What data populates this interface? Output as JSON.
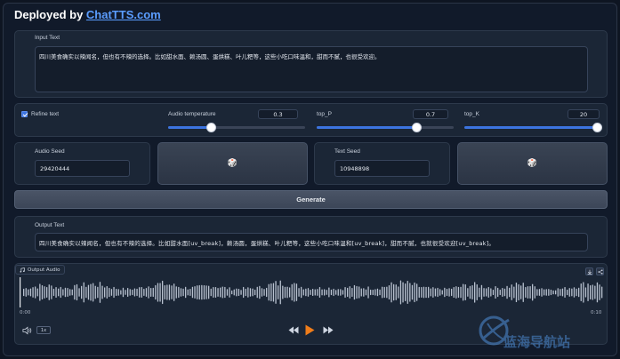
{
  "header": {
    "prefix": "Deployed by ",
    "link": "ChatTTS.com"
  },
  "input": {
    "label": "Input Text",
    "value": "四川美食确实以辣闻名，但也有不辣的选择。比如甜水面、赖汤圆、蛋烘糕、叶儿粑等，这些小吃口味温和，甜而不腻，也很受欢迎。"
  },
  "options": {
    "refine_label": "Refine text",
    "refine_checked": true,
    "temperature": {
      "label": "Audio temperature",
      "value": "0.3",
      "fraction": 0.3
    },
    "top_p": {
      "label": "top_P",
      "value": "0.7",
      "fraction": 0.7
    },
    "top_k": {
      "label": "top_K",
      "value": "20",
      "fraction": 1.0
    }
  },
  "audio_seed": {
    "label": "Audio Seed",
    "value": "29420444",
    "dice": "🎲"
  },
  "text_seed": {
    "label": "Text Seed",
    "value": "10948898",
    "dice": "🎲"
  },
  "generate_label": "Generate",
  "output": {
    "label": "Output Text",
    "value": "四川美食确实以辣闻名，但也有不辣的选择。比如甜水面[uv_break]，赖汤圆，蛋烘糕、叶儿粑等，这些小吃口味温和[uv_break]，甜而不腻，也就很受欢迎[uv_break]。"
  },
  "player": {
    "label": "Output Audio",
    "current_time": "0:00",
    "duration": "0:10",
    "speed": "1x",
    "icons": [
      "music-icon",
      "download-icon",
      "share-icon",
      "volume-icon",
      "rewind-icon",
      "play-icon",
      "forward-icon"
    ],
    "accent": "#f07d1a"
  },
  "watermark": {
    "text": "蓝海导航站"
  }
}
